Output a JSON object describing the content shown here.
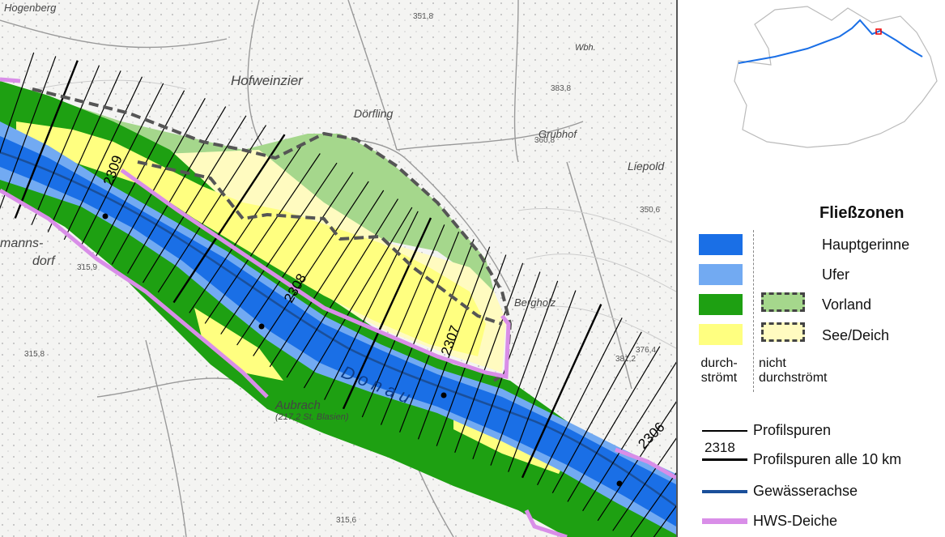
{
  "map": {
    "place_labels": [
      {
        "text": "Hofweinzier"
      },
      {
        "text": "Dörfling"
      },
      {
        "text": "Grubhof"
      },
      {
        "text": "Liepold"
      },
      {
        "text": "Bergholz"
      },
      {
        "text": "Aubrach"
      },
      {
        "text": "(217,2 St. Blasien)"
      },
      {
        "text": "Hogenberg"
      },
      {
        "text": "manns-"
      },
      {
        "text": "dorf"
      },
      {
        "text": "Wbh."
      },
      {
        "text": "351,8"
      },
      {
        "text": "383,8"
      },
      {
        "text": "315,8"
      },
      {
        "text": "315,6"
      },
      {
        "text": "315,9"
      },
      {
        "text": "350,6"
      },
      {
        "text": "381,2"
      },
      {
        "text": "376,4"
      },
      {
        "text": "360,8"
      }
    ],
    "profile_km_labels": [
      "2309",
      "2308",
      "2307",
      "2306"
    ],
    "river_label": "D o n a u"
  },
  "legend": {
    "title": "Fließzonen",
    "items": [
      {
        "label": "Hauptgerinne"
      },
      {
        "label": "Ufer"
      },
      {
        "label": "Vorland"
      },
      {
        "label": "See/Deich"
      }
    ],
    "col_left": "durch- strömt",
    "col_right": "nicht durchströmt",
    "profile_label": "Profilspuren",
    "profile10_number": "2318",
    "profile10_label": "Profilspuren alle 10 km",
    "axis_label": "Gewässerachse",
    "dike_label": "HWS-Deiche"
  },
  "colors": {
    "hauptgerinne": "#1a6fe6",
    "ufer": "#72aaf2",
    "vorland": "#1ea012",
    "see_deich": "#ffff80",
    "vorland_nd": "#a5d78c",
    "see_deich_nd": "#fffbc0",
    "axis": "#1a4f9a",
    "dike": "#d98ee8"
  }
}
